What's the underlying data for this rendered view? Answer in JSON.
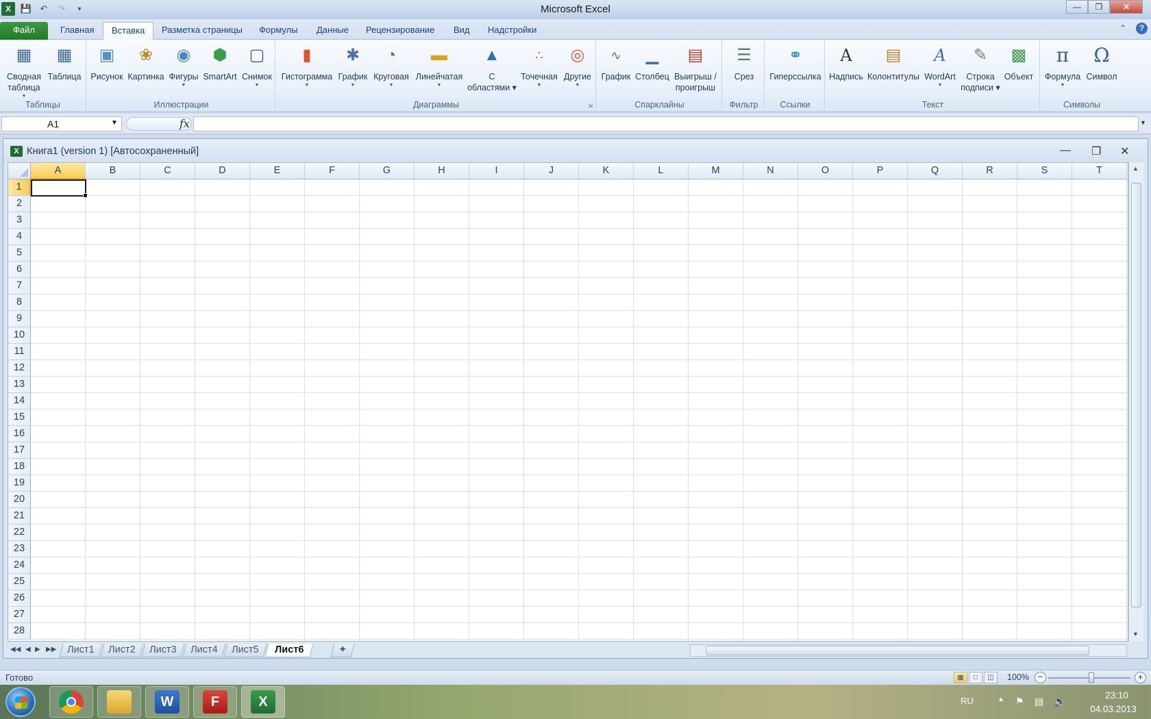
{
  "window": {
    "title": "Microsoft Excel"
  },
  "ribbon": {
    "tabs": [
      {
        "label": "Файл"
      },
      {
        "label": "Главная"
      },
      {
        "label": "Вставка"
      },
      {
        "label": "Разметка страницы"
      },
      {
        "label": "Формулы"
      },
      {
        "label": "Данные"
      },
      {
        "label": "Рецензирование"
      },
      {
        "label": "Вид"
      },
      {
        "label": "Надстройки"
      }
    ],
    "active_tab": "Вставка",
    "groups": {
      "tables": {
        "label": "Таблицы",
        "pivot_line1": "Сводная",
        "pivot_line2": "таблица",
        "table": "Таблица"
      },
      "illustrations": {
        "label": "Иллюстрации",
        "picture": "Рисунок",
        "clipart": "Картинка",
        "shapes": "Фигуры",
        "smartart": "SmartArt",
        "screenshot": "Снимок"
      },
      "charts": {
        "label": "Диаграммы",
        "column": "Гистограмма",
        "line": "График",
        "pie": "Круговая",
        "bar": "Линейчатая",
        "area_line1": "С",
        "area_line2": "областями",
        "scatter": "Точечная",
        "other": "Другие"
      },
      "sparklines": {
        "label": "Спарклайны",
        "line": "График",
        "column": "Столбец",
        "winloss_line1": "Выигрыш /",
        "winloss_line2": "проигрыш"
      },
      "filter": {
        "label": "Фильтр",
        "slicer": "Срез"
      },
      "links": {
        "label": "Ссылки",
        "hyperlink": "Гиперссылка"
      },
      "text": {
        "label": "Текст",
        "textbox": "Надпись",
        "header_footer": "Колонтитулы",
        "wordart": "WordArt",
        "sigline_line1": "Строка",
        "sigline_line2": "подписи",
        "object": "Объект"
      },
      "symbols": {
        "label": "Символы",
        "equation": "Формула",
        "symbol": "Символ"
      }
    }
  },
  "formula_bar": {
    "name_box": "A1",
    "fx": "fx",
    "formula": ""
  },
  "workbook": {
    "title": "Книга1 (version 1) [Автосохраненный]",
    "columns": [
      "A",
      "B",
      "C",
      "D",
      "E",
      "F",
      "G",
      "H",
      "I",
      "J",
      "K",
      "L",
      "M",
      "N",
      "O",
      "P",
      "Q",
      "R",
      "S",
      "T"
    ],
    "rows": [
      "1",
      "2",
      "3",
      "4",
      "5",
      "6",
      "7",
      "8",
      "9",
      "10",
      "11",
      "12",
      "13",
      "14",
      "15",
      "16",
      "17",
      "18",
      "19",
      "20",
      "21",
      "22",
      "23",
      "24",
      "25",
      "26",
      "27",
      "28"
    ],
    "active_cell": "A1",
    "sheets": [
      "Лист1",
      "Лист2",
      "Лист3",
      "Лист4",
      "Лист5",
      "Лист6"
    ],
    "active_sheet": "Лист6"
  },
  "status": {
    "ready": "Готово",
    "zoom": "100%"
  },
  "taskbar": {
    "lang": "RU",
    "time": "23:10",
    "date": "04.03.2013"
  },
  "colors": {
    "accent_green": "#1f7b26",
    "selection_gold": "#f9cd52",
    "ribbon_blue": "#15428b"
  }
}
